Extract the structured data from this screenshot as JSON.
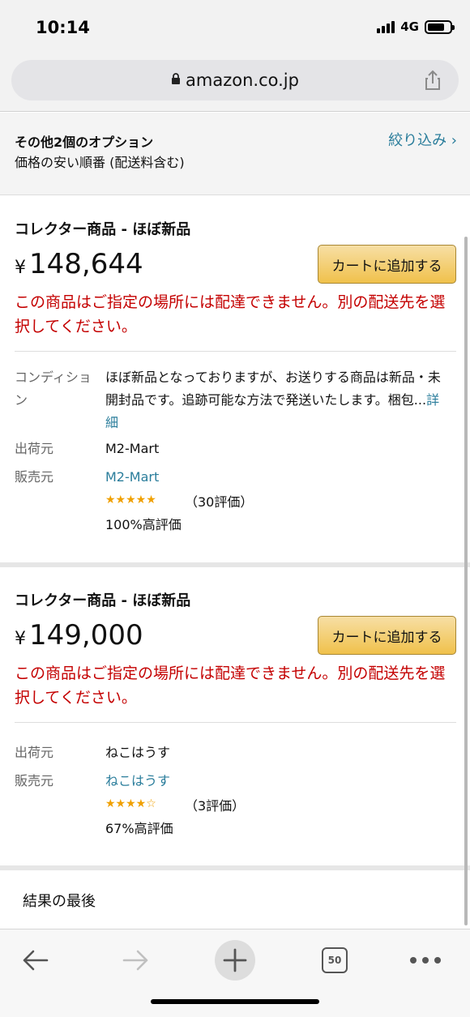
{
  "status": {
    "time": "10:14",
    "network": "4G"
  },
  "browser": {
    "url": "amazon.co.jp",
    "tab_count": "50"
  },
  "options": {
    "title": "その他2個のオプション",
    "subtitle": "価格の安い順番 (配送料含む)",
    "filter_label": "絞り込み ›"
  },
  "listings": [
    {
      "condition": "コレクター商品 - ほぼ新品",
      "currency": "¥",
      "price": "148,644",
      "cart_button": "カートに追加する",
      "warning": "この商品はご指定の場所には配達できません。別の配送先を選択してください。",
      "condition_label": "コンディション",
      "condition_note": "ほぼ新品となっておりますが、お送りする商品は新品・未開封品です。追跡可能な方法で発送いたします。梱包...",
      "more_link": "詳細",
      "ships_from_label": "出荷元",
      "ships_from": "M2-Mart",
      "sold_by_label": "販売元",
      "sold_by": "M2-Mart",
      "stars": "★★★★★",
      "rating_count": "（30評価）",
      "positive": "100%高評価"
    },
    {
      "condition": "コレクター商品 - ほぼ新品",
      "currency": "¥",
      "price": "149,000",
      "cart_button": "カートに追加する",
      "warning": "この商品はご指定の場所には配達できません。別の配送先を選択してください。",
      "ships_from_label": "出荷元",
      "ships_from": "ねこはうす",
      "sold_by_label": "販売元",
      "sold_by": "ねこはうす",
      "stars": "★★★★☆",
      "rating_count": "（3評価）",
      "positive": "67%高評価"
    }
  ],
  "end_text": "結果の最後",
  "colors": {
    "warning": "#c40000",
    "link": "#2a7d9b",
    "cart_button": "#f0c14b",
    "stars": "#f0a000"
  },
  "icons": [
    "lock-icon",
    "share-icon",
    "back-arrow-icon",
    "forward-arrow-icon",
    "plus-icon",
    "tabs-icon",
    "more-icon"
  ]
}
